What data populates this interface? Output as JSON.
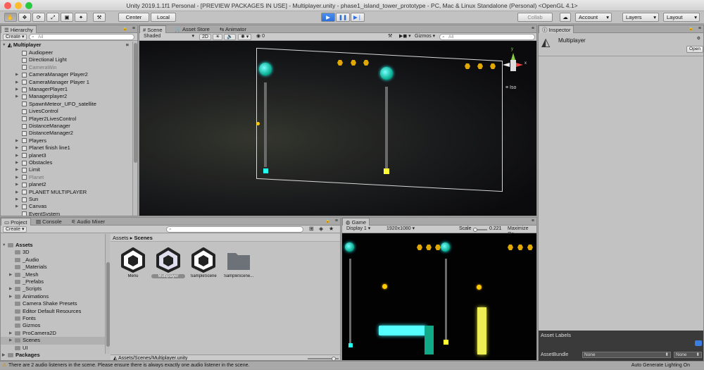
{
  "window": {
    "title": "Unity 2019.1.1f1 Personal - [PREVIEW PACKAGES IN USE] - Multiplayer.unity - phase1_island_tower_prototype - PC, Mac & Linux Standalone (Personal) <OpenGL 4.1>"
  },
  "toolbar": {
    "center": "Center",
    "local": "Local",
    "collab": "Collab",
    "account": "Account",
    "layers": "Layers",
    "layout": "Layout"
  },
  "hierarchy": {
    "tab": "Hierarchy",
    "create": "Create",
    "search_placeholder": "All",
    "scene": "Multiplayer",
    "items": [
      {
        "label": "Audiopeer",
        "arrow": false,
        "disabled": false
      },
      {
        "label": "Directional Light",
        "arrow": false,
        "disabled": false
      },
      {
        "label": "CameraWin",
        "arrow": false,
        "disabled": true
      },
      {
        "label": "CameraManager Player2",
        "arrow": true,
        "disabled": false
      },
      {
        "label": "CameraManager Player 1",
        "arrow": true,
        "disabled": false
      },
      {
        "label": "ManagerPlayer1",
        "arrow": true,
        "disabled": false
      },
      {
        "label": "Managerplayer2",
        "arrow": true,
        "disabled": false
      },
      {
        "label": "SpawnMeteor_UFO_satellite",
        "arrow": false,
        "disabled": false
      },
      {
        "label": "LivesControl",
        "arrow": false,
        "disabled": false
      },
      {
        "label": "Player2LivesControl",
        "arrow": false,
        "disabled": false
      },
      {
        "label": "DistanceManager",
        "arrow": false,
        "disabled": false
      },
      {
        "label": "DistanceManager2",
        "arrow": false,
        "disabled": false
      },
      {
        "label": "Players",
        "arrow": true,
        "disabled": false
      },
      {
        "label": "Planet finish line1",
        "arrow": true,
        "disabled": false
      },
      {
        "label": "planet3",
        "arrow": true,
        "disabled": false
      },
      {
        "label": "Obstacles",
        "arrow": true,
        "disabled": false
      },
      {
        "label": "Limit",
        "arrow": true,
        "disabled": false
      },
      {
        "label": "Planet",
        "arrow": true,
        "disabled": true
      },
      {
        "label": "planet2",
        "arrow": true,
        "disabled": false
      },
      {
        "label": "PLANET MULTIPLAYER",
        "arrow": true,
        "disabled": false
      },
      {
        "label": "Sun",
        "arrow": true,
        "disabled": false
      },
      {
        "label": "Canvas",
        "arrow": true,
        "disabled": false
      },
      {
        "label": "EventSystem",
        "arrow": false,
        "disabled": false
      }
    ]
  },
  "scene_view": {
    "tabs": [
      "Scene",
      "Asset Store",
      "Animator"
    ],
    "shading": "Shaded",
    "mode_2d": "2D",
    "fx_count": "0",
    "gizmos": "Gizmos",
    "search_placeholder": "All",
    "iso_label": "Iso",
    "gizmo_y": "y",
    "gizmo_x": "x"
  },
  "inspector": {
    "tab": "Inspector",
    "object_name": "Multiplayer",
    "open_button": "Open",
    "asset_labels": "Asset Labels",
    "asset_bundle": "AssetBundle",
    "none1": "None",
    "none2": "None"
  },
  "project": {
    "tabs": [
      "Project",
      "Console",
      "Audio Mixer"
    ],
    "create": "Create",
    "tree": [
      {
        "label": "Assets",
        "level": 0,
        "arrow": true,
        "bold": true
      },
      {
        "label": "3D",
        "level": 1,
        "arrow": false,
        "bold": false
      },
      {
        "label": "_Audio",
        "level": 1,
        "arrow": false,
        "bold": false
      },
      {
        "label": "_Materials",
        "level": 1,
        "arrow": false,
        "bold": false
      },
      {
        "label": "_Mesh",
        "level": 1,
        "arrow": true,
        "bold": false
      },
      {
        "label": "_Prefabs",
        "level": 1,
        "arrow": false,
        "bold": false
      },
      {
        "label": "_Scripts",
        "level": 1,
        "arrow": true,
        "bold": false
      },
      {
        "label": "Animations",
        "level": 1,
        "arrow": true,
        "bold": false
      },
      {
        "label": "Camera Shake Presets",
        "level": 1,
        "arrow": false,
        "bold": false
      },
      {
        "label": "Editor Default Resources",
        "level": 1,
        "arrow": false,
        "bold": false
      },
      {
        "label": "Fonts",
        "level": 1,
        "arrow": false,
        "bold": false
      },
      {
        "label": "Gizmos",
        "level": 1,
        "arrow": false,
        "bold": false
      },
      {
        "label": "ProCamera2D",
        "level": 1,
        "arrow": true,
        "bold": false
      },
      {
        "label": "Scenes",
        "level": 1,
        "arrow": true,
        "bold": false,
        "selected": true
      },
      {
        "label": "UI",
        "level": 1,
        "arrow": false,
        "bold": false
      },
      {
        "label": "Packages",
        "level": 0,
        "arrow": true,
        "bold": true
      }
    ],
    "breadcrumb_root": "Assets",
    "breadcrumb_sep": "▸",
    "breadcrumb_current": "Scenes",
    "assets": [
      {
        "label": "Menu",
        "kind": "unity",
        "selected": false
      },
      {
        "label": "Multiplayer",
        "kind": "unity",
        "selected": true
      },
      {
        "label": "SampleScene",
        "kind": "unity",
        "selected": false
      },
      {
        "label": "SampleScene...",
        "kind": "folder",
        "selected": false
      }
    ],
    "path": "Assets/Scenes/Multiplayer.unity",
    "lock_count": "16"
  },
  "game_view": {
    "tab": "Game",
    "display": "Display 1",
    "resolution": "1920x1080",
    "scale_label": "Scale",
    "scale_value": "0.221",
    "maximize": "Maximize On"
  },
  "status": {
    "message": "There are 2 audio listeners in the scene. Please ensure there is always exactly one audio listener in the scene.",
    "right": "Auto Generate Lighting On"
  },
  "colors": {
    "accent_blue": "#3c7de0",
    "planet_cyan": "#00d8c8",
    "coin_gold": "#e0a800",
    "warning": "#f0c000"
  }
}
